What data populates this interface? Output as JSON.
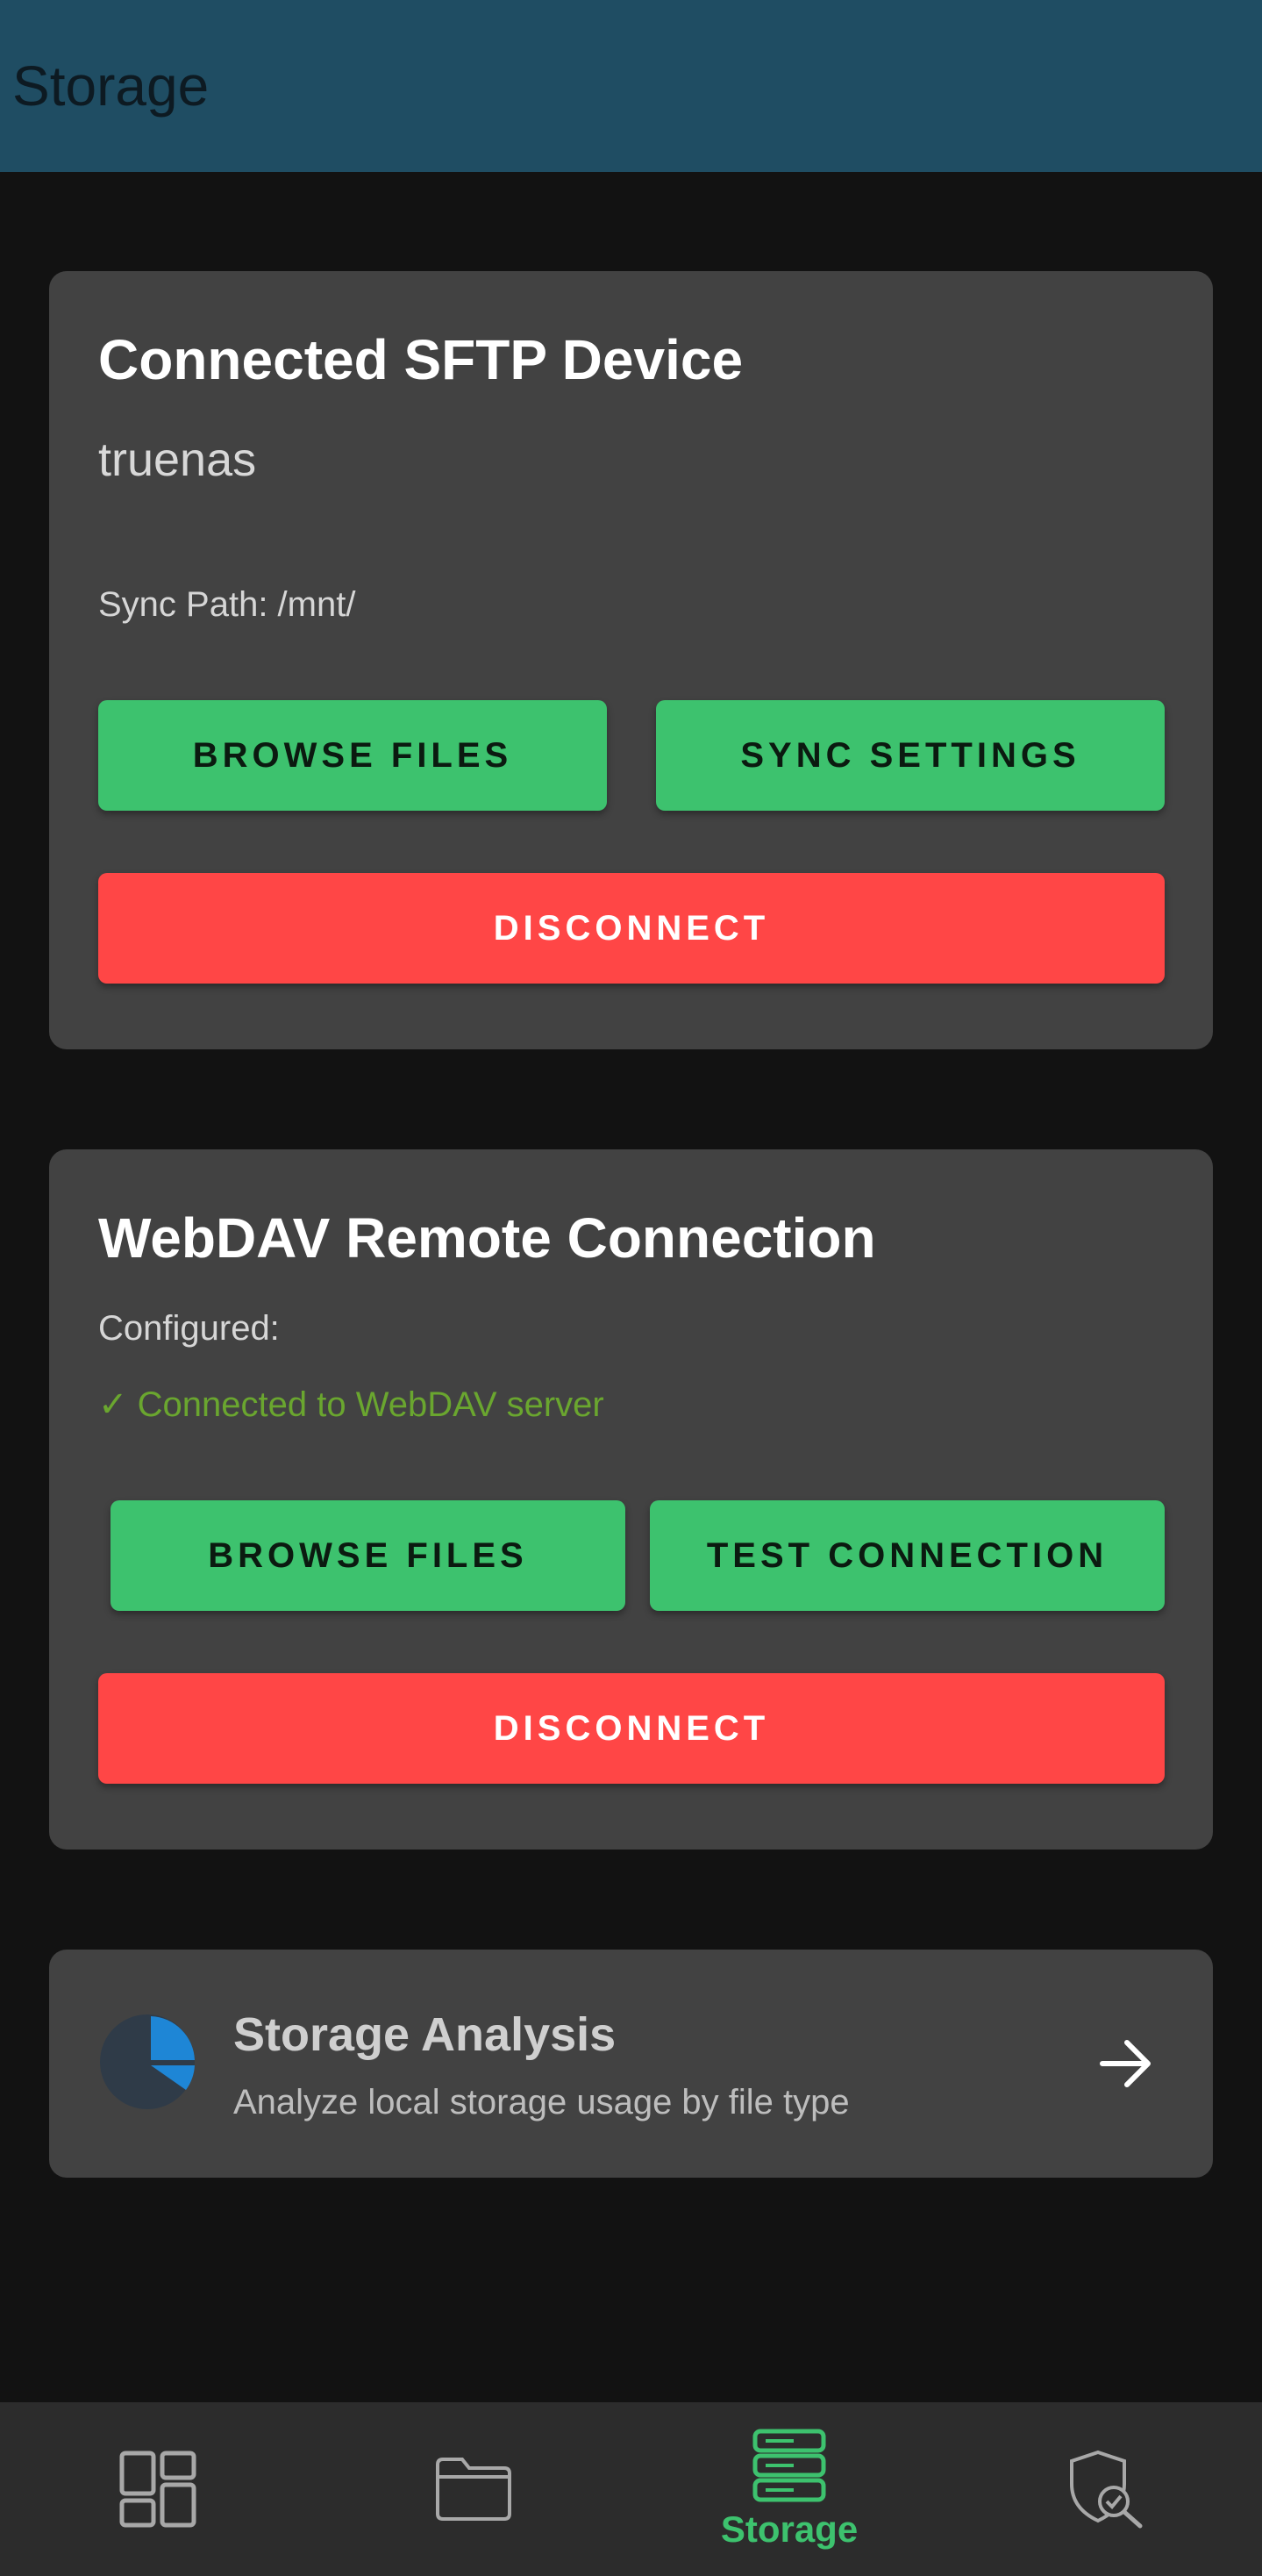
{
  "app_bar": {
    "title": "Storage"
  },
  "sftp_card": {
    "title": "Connected SFTP Device",
    "device_name": "truenas",
    "sync_path": "Sync Path: /mnt/",
    "browse_label": "BROWSE FILES",
    "sync_settings_label": "SYNC SETTINGS",
    "disconnect_label": "DISCONNECT"
  },
  "webdav_card": {
    "title": "WebDAV Remote Connection",
    "configured_label": "Configured:",
    "status": "✓ Connected to WebDAV server",
    "browse_label": "BROWSE FILES",
    "test_label": "TEST CONNECTION",
    "disconnect_label": "DISCONNECT"
  },
  "analysis_card": {
    "title": "Storage Analysis",
    "description": "Analyze local storage usage by file type",
    "icon": "pie-chart-icon"
  },
  "bottom_nav": {
    "items": [
      {
        "icon": "dashboard-icon",
        "label": ""
      },
      {
        "icon": "folder-icon",
        "label": ""
      },
      {
        "icon": "storage-icon",
        "label": "Storage",
        "active": true
      },
      {
        "icon": "security-scan-icon",
        "label": ""
      }
    ]
  },
  "colors": {
    "app_bar": "#1f4d63",
    "card": "#424242",
    "primary_green": "#3dc26e",
    "danger_red": "#ff4646",
    "status_green": "#6aa62f",
    "nav_bg": "#2c2c2c"
  }
}
